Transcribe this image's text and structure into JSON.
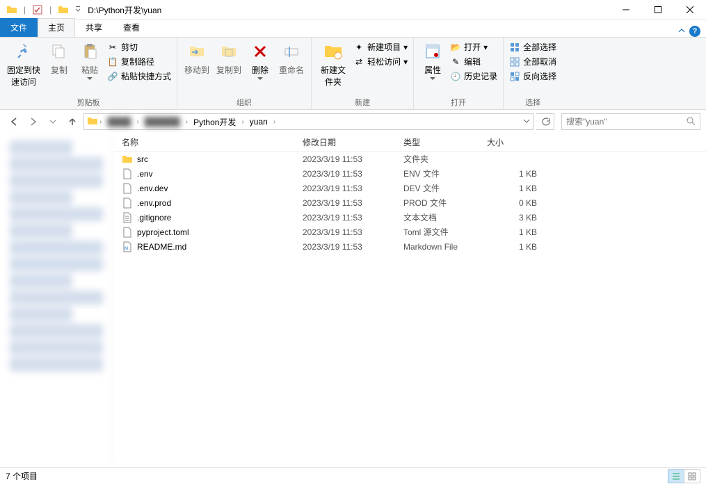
{
  "window": {
    "path_prefix": "D:\\Python开发\\yuan",
    "separator": "|"
  },
  "tabs": {
    "file": "文件",
    "home": "主页",
    "share": "共享",
    "view": "查看"
  },
  "ribbon": {
    "clipboard": {
      "pin": "固定到快速访问",
      "copy": "复制",
      "paste": "粘贴",
      "cut": "剪切",
      "copy_path": "复制路径",
      "paste_shortcut": "粘贴快捷方式",
      "label": "剪贴板"
    },
    "organize": {
      "move_to": "移动到",
      "copy_to": "复制到",
      "delete": "删除",
      "rename": "重命名",
      "label": "组织"
    },
    "new": {
      "new_folder": "新建文件夹",
      "new_item": "新建项目",
      "easy_access": "轻松访问",
      "label": "新建"
    },
    "open": {
      "properties": "属性",
      "open": "打开",
      "edit": "编辑",
      "history": "历史记录",
      "label": "打开"
    },
    "select": {
      "select_all": "全部选择",
      "select_none": "全部取消",
      "invert": "反向选择",
      "label": "选择"
    }
  },
  "breadcrumb": {
    "hidden1": "████",
    "hidden2": "██████",
    "seg1": "Python开发",
    "seg2": "yuan"
  },
  "search": {
    "placeholder": "搜索\"yuan\""
  },
  "columns": {
    "name": "名称",
    "date": "修改日期",
    "type": "类型",
    "size": "大小"
  },
  "files": [
    {
      "icon": "folder",
      "name": "src",
      "date": "2023/3/19 11:53",
      "type": "文件夹",
      "size": ""
    },
    {
      "icon": "file",
      "name": ".env",
      "date": "2023/3/19 11:53",
      "type": "ENV 文件",
      "size": "1 KB"
    },
    {
      "icon": "file",
      "name": ".env.dev",
      "date": "2023/3/19 11:53",
      "type": "DEV 文件",
      "size": "1 KB"
    },
    {
      "icon": "file",
      "name": ".env.prod",
      "date": "2023/3/19 11:53",
      "type": "PROD 文件",
      "size": "0 KB"
    },
    {
      "icon": "text",
      "name": ".gitignore",
      "date": "2023/3/19 11:53",
      "type": "文本文档",
      "size": "3 KB"
    },
    {
      "icon": "file",
      "name": "pyproject.toml",
      "date": "2023/3/19 11:53",
      "type": "Toml 源文件",
      "size": "1 KB"
    },
    {
      "icon": "md",
      "name": "README.md",
      "date": "2023/3/19 11:53",
      "type": "Markdown File",
      "size": "1 KB"
    }
  ],
  "status": {
    "count": "7 个项目"
  }
}
